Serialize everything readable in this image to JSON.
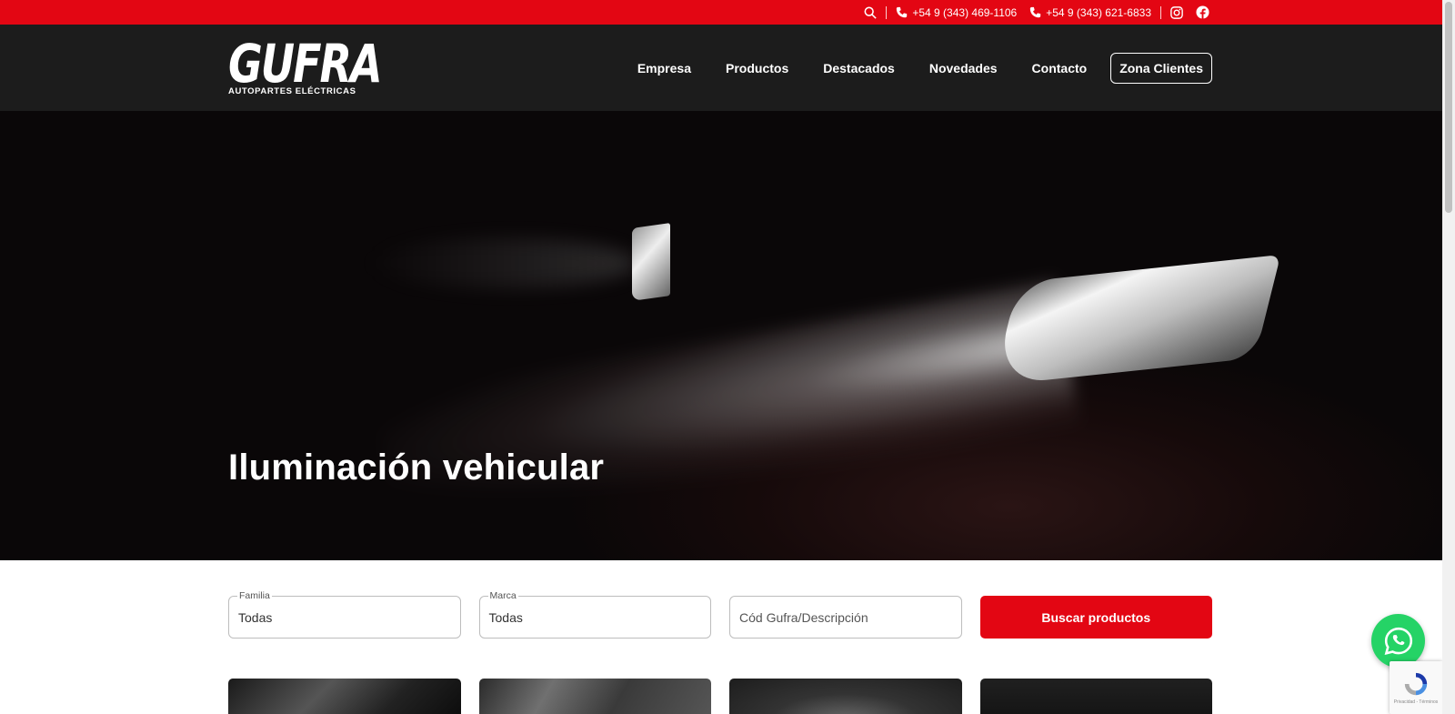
{
  "topbar": {
    "phones": [
      "+54 9 (343) 469-1106",
      "+54 9 (343) 621-6833"
    ],
    "background": "#e30613"
  },
  "header": {
    "logo_brand": "GUFRA",
    "logo_tagline": "AUTOPARTES ELÉCTRICAS",
    "nav": [
      "Empresa",
      "Productos",
      "Destacados",
      "Novedades",
      "Contacto"
    ],
    "cta_label": "Zona Clientes"
  },
  "hero": {
    "title": "Iluminación vehicular"
  },
  "search": {
    "familia": {
      "legend": "Familia",
      "value": "Todas"
    },
    "marca": {
      "legend": "Marca",
      "value": "Todas"
    },
    "codigo": {
      "placeholder": "Cód Gufra/Descripción"
    },
    "button_label": "Buscar productos"
  },
  "recaptcha": {
    "text": "Privacidad - Términos"
  },
  "colors": {
    "accent": "#e30613",
    "header_bg": "#1c1c1c",
    "whatsapp": "#25d366"
  }
}
